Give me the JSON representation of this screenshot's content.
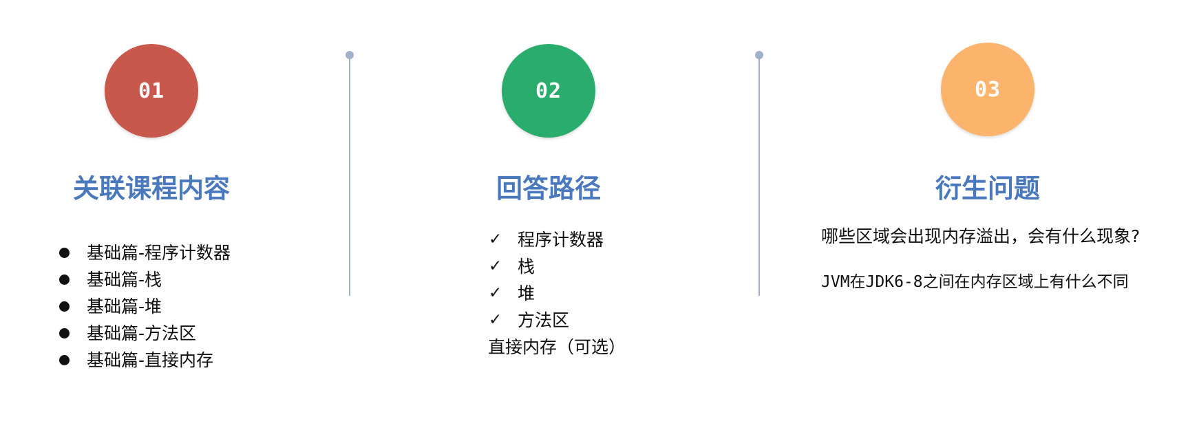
{
  "sections": [
    {
      "number": "01",
      "color": "#c7584b",
      "title": "关联课程内容",
      "items": [
        "基础篇-程序计数器",
        "基础篇-栈",
        "基础篇-堆",
        "基础篇-方法区",
        "基础篇-直接内存"
      ]
    },
    {
      "number": "02",
      "color": "#2aac6c",
      "title": "回答路径",
      "checked_items": [
        "程序计数器",
        "栈",
        "堆",
        "方法区"
      ],
      "check_icon": "✓",
      "extra": "直接内存（可选）"
    },
    {
      "number": "03",
      "color": "#fcb46c",
      "title": "衍生问题",
      "questions": [
        "哪些区域会出现内存溢出，会有什么现象?",
        "JVM在JDK6-8之间在内存区域上有什么不同"
      ]
    }
  ],
  "title_color": "#4a78bd",
  "divider_color": "#9fb0c8"
}
